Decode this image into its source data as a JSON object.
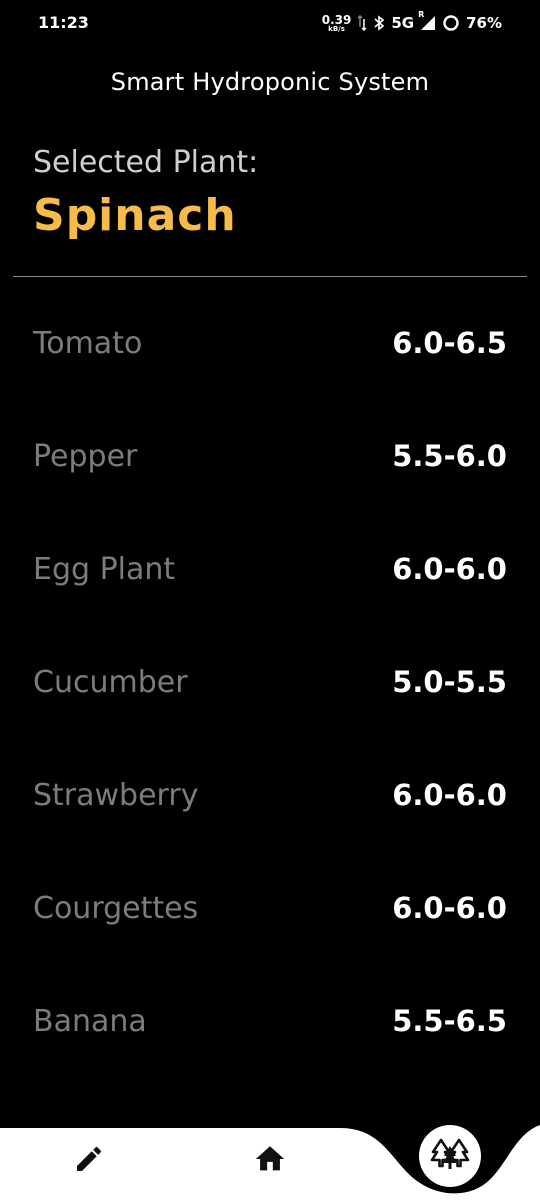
{
  "status_bar": {
    "time": "11:23",
    "net_speed": "0.39",
    "net_unit": "kB/s",
    "network": "5G",
    "roaming": "R",
    "battery": "76%"
  },
  "app": {
    "title": "Smart Hydroponic System"
  },
  "selected": {
    "label": "Selected Plant:",
    "value": "Spinach"
  },
  "plants": [
    {
      "name": "Tomato",
      "ph": "6.0-6.5"
    },
    {
      "name": "Pepper",
      "ph": "5.5-6.0"
    },
    {
      "name": "Egg Plant",
      "ph": "6.0-6.0"
    },
    {
      "name": "Cucumber",
      "ph": "5.0-5.5"
    },
    {
      "name": "Strawberry",
      "ph": "6.0-6.0"
    },
    {
      "name": "Courgettes",
      "ph": "6.0-6.0"
    },
    {
      "name": "Banana",
      "ph": "5.5-6.5"
    }
  ],
  "nav": {
    "items": [
      "pencil-icon",
      "home-icon",
      "trees-icon"
    ]
  },
  "colors": {
    "accent": "#f5bc4a",
    "background": "#000000",
    "muted_text": "#7c7c7c"
  }
}
